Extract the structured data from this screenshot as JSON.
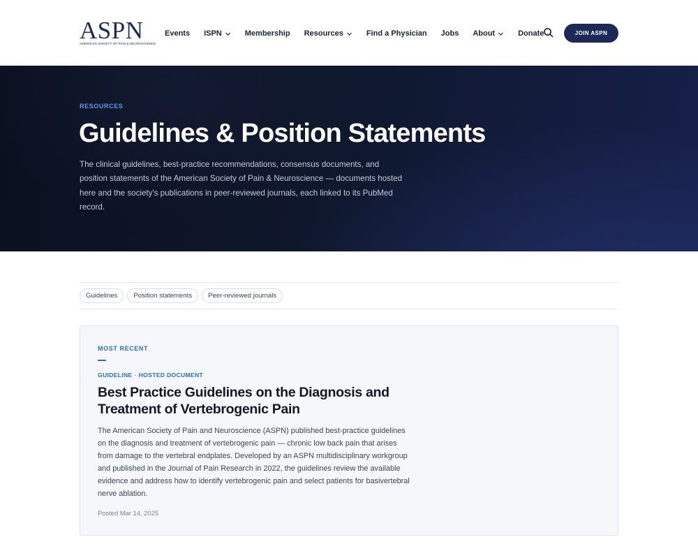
{
  "header": {
    "logo": {
      "wordmark": "ASPN",
      "subtitle": "AMERICAN SOCIETY OF PAIN & NEUROSCIENCE"
    },
    "nav": [
      {
        "label": "Events",
        "dropdown": false
      },
      {
        "label": "ISPN",
        "dropdown": true
      },
      {
        "label": "Membership",
        "dropdown": false
      },
      {
        "label": "Resources",
        "dropdown": true
      },
      {
        "label": "Find a Physician",
        "dropdown": false
      },
      {
        "label": "Jobs",
        "dropdown": false
      },
      {
        "label": "About",
        "dropdown": true
      },
      {
        "label": "Donate",
        "dropdown": false
      }
    ],
    "search_icon": "search-icon",
    "join_label": "JOIN ASPN"
  },
  "hero": {
    "eyebrow": "RESOURCES",
    "title": "Guidelines & Position Statements",
    "description": "The clinical guidelines, best-practice recommendations, consensus documents, and position statements of the American Society of Pain & Neuroscience — documents hosted here and the society's publications in peer-reviewed journals, each linked to its PubMed record."
  },
  "filters": [
    "Guidelines",
    "Position statements",
    "Peer-reviewed journals"
  ],
  "featured": {
    "eyebrow": "MOST RECENT",
    "type": "GUIDELINE",
    "source": "HOSTED DOCUMENT",
    "separator": "·",
    "title": "Best Practice Guidelines on the Diagnosis and Treatment of Vertebrogenic Pain",
    "summary": "The American Society of Pain and Neuroscience (ASPN) published best-practice guidelines on the diagnosis and treatment of vertebrogenic pain — chronic low back pain that arises from damage to the vertebral endplates. Developed by an ASPN multidisciplinary workgroup and published in the Journal of Pain Research in 2022, the guidelines review the available evidence and address how to identify vertebrogenic pain and select patients for basivertebral nerve ablation.",
    "posted": "Posted Mar 14, 2025"
  },
  "colors": {
    "brand_navy": "#1c2858",
    "accent_blue": "#2c6fcb",
    "hero_eyebrow": "#5b9bef",
    "card_bg": "#f5f7fa"
  }
}
